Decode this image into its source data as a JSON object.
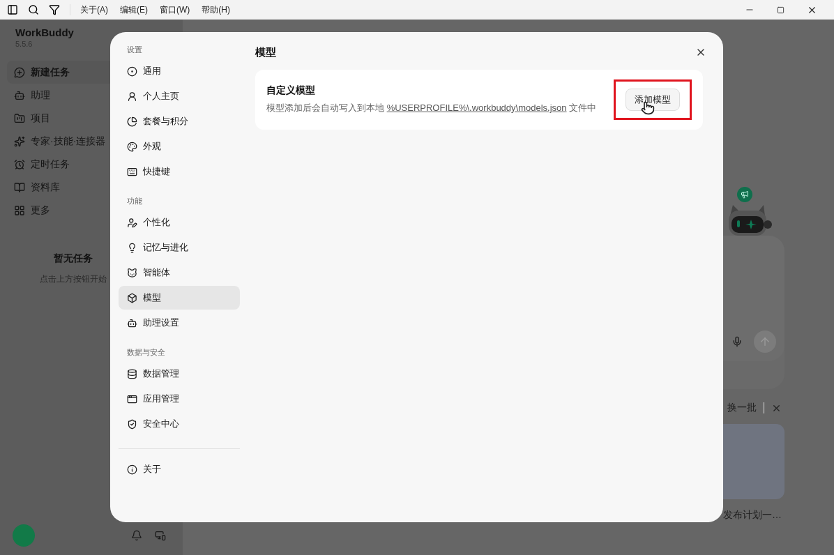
{
  "menu_bar": {
    "items": [
      "关于(A)",
      "编辑(E)",
      "窗口(W)",
      "帮助(H)"
    ]
  },
  "app_sidebar": {
    "brand": "WorkBuddy",
    "version": "5.5.6",
    "items": [
      {
        "label": "新建任务",
        "selected": true
      },
      {
        "label": "助理",
        "selected": false
      },
      {
        "label": "项目",
        "selected": false
      },
      {
        "label": "专家·技能·连接器",
        "selected": false
      },
      {
        "label": "定时任务",
        "selected": false
      },
      {
        "label": "资料库",
        "selected": false
      },
      {
        "label": "更多",
        "selected": false
      }
    ],
    "empty_title": "暂无任务",
    "empty_hint": "点击上方按钮开始"
  },
  "main": {
    "refresh": "换一批",
    "card_caption": "发布计划一…"
  },
  "settings": {
    "sections": [
      {
        "heading": "设置",
        "items": [
          {
            "label": "通用",
            "selected": false
          },
          {
            "label": "个人主页",
            "selected": false
          },
          {
            "label": "套餐与积分",
            "selected": false
          },
          {
            "label": "外观",
            "selected": false
          },
          {
            "label": "快捷键",
            "selected": false
          }
        ]
      },
      {
        "heading": "功能",
        "items": [
          {
            "label": "个性化",
            "selected": false
          },
          {
            "label": "记忆与进化",
            "selected": false
          },
          {
            "label": "智能体",
            "selected": false
          },
          {
            "label": "模型",
            "selected": true
          },
          {
            "label": "助理设置",
            "selected": false
          }
        ]
      },
      {
        "heading": "数据与安全",
        "items": [
          {
            "label": "数据管理",
            "selected": false
          },
          {
            "label": "应用管理",
            "selected": false
          },
          {
            "label": "安全中心",
            "selected": false
          }
        ]
      }
    ],
    "footer_items": [
      {
        "label": "关于",
        "selected": false
      }
    ],
    "page_title": "模型",
    "card": {
      "title": "自定义模型",
      "text_before": "模型添加后会自动写入到本地 ",
      "link": "%USERPROFILE%\\.workbuddy\\models.json",
      "text_after": " 文件中",
      "button": "添加模型",
      "highlighted": true
    }
  }
}
